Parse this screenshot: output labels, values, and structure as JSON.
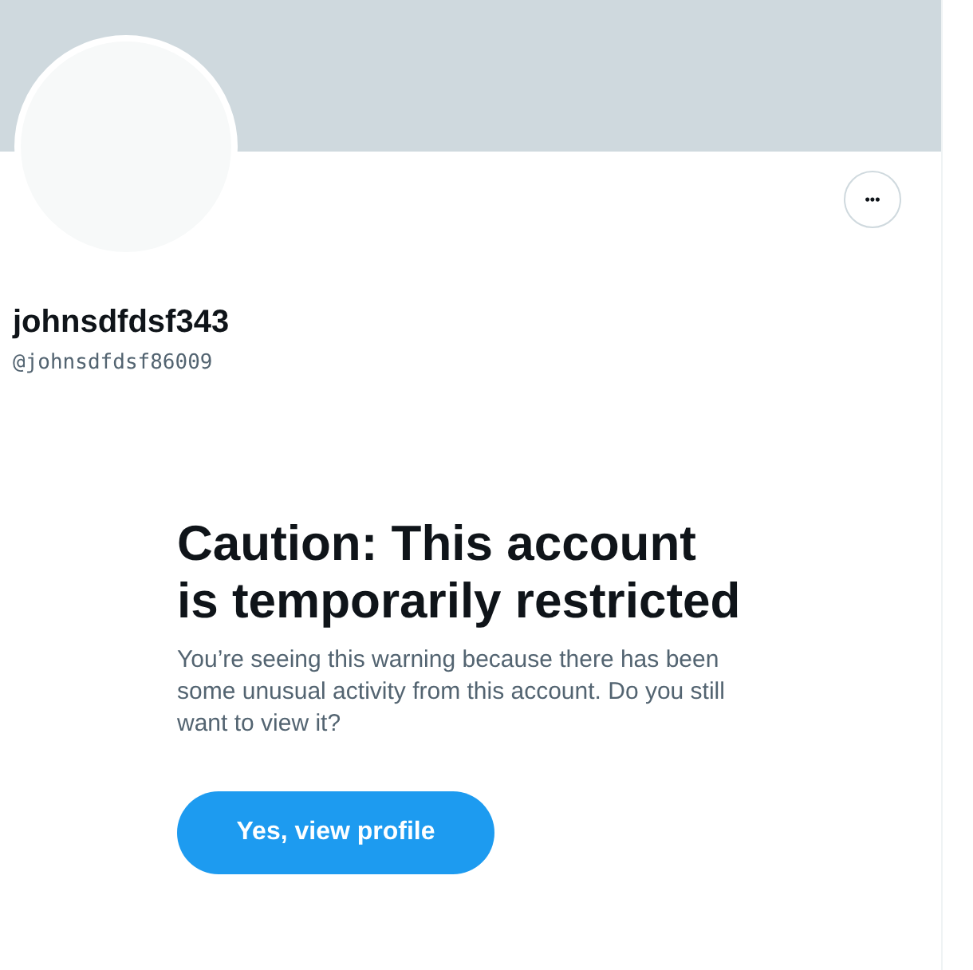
{
  "profile": {
    "display_name": "johnsdfdsf343",
    "handle": "@johnsdfdsf86009"
  },
  "more_button": {
    "label": "•••"
  },
  "warning": {
    "title": "Caution: This account is temporarily restricted",
    "message": "You’re seeing this warning because there has been some unusual activity from this account. Do you still want to view it?",
    "button": "Yes, view profile"
  }
}
